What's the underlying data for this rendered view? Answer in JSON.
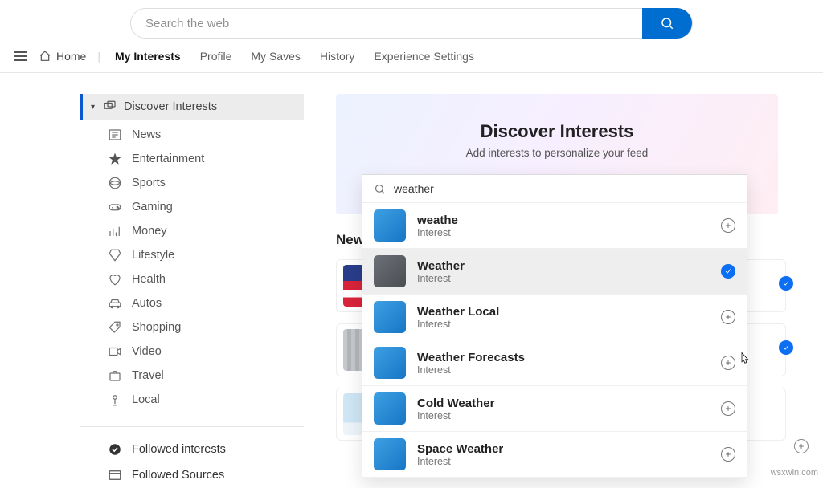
{
  "search": {
    "placeholder": "Search the web"
  },
  "nav": {
    "home": "Home",
    "tabs": [
      "My Interests",
      "Profile",
      "My Saves",
      "History",
      "Experience Settings"
    ],
    "active": 0
  },
  "sidebar": {
    "header": "Discover Interests",
    "items": [
      {
        "label": "News"
      },
      {
        "label": "Entertainment"
      },
      {
        "label": "Sports"
      },
      {
        "label": "Gaming"
      },
      {
        "label": "Money"
      },
      {
        "label": "Lifestyle"
      },
      {
        "label": "Health"
      },
      {
        "label": "Autos"
      },
      {
        "label": "Shopping"
      },
      {
        "label": "Video"
      },
      {
        "label": "Travel"
      },
      {
        "label": "Local"
      }
    ],
    "follow": [
      "Followed interests",
      "Followed Sources"
    ]
  },
  "hero": {
    "title": "Discover Interests",
    "subtitle": "Add interests to personalize your feed"
  },
  "section_title": "News",
  "suggest": {
    "query": "weather",
    "type_label": "Interest",
    "items": [
      {
        "title": "weathe",
        "selected": false
      },
      {
        "title": "Weather",
        "selected": true,
        "hover": true
      },
      {
        "title": "Weather Local",
        "selected": false
      },
      {
        "title": "Weather Forecasts",
        "selected": false
      },
      {
        "title": "Cold Weather",
        "selected": false
      },
      {
        "title": "Space Weather",
        "selected": false
      }
    ]
  },
  "watermark": "wsxwin.com"
}
